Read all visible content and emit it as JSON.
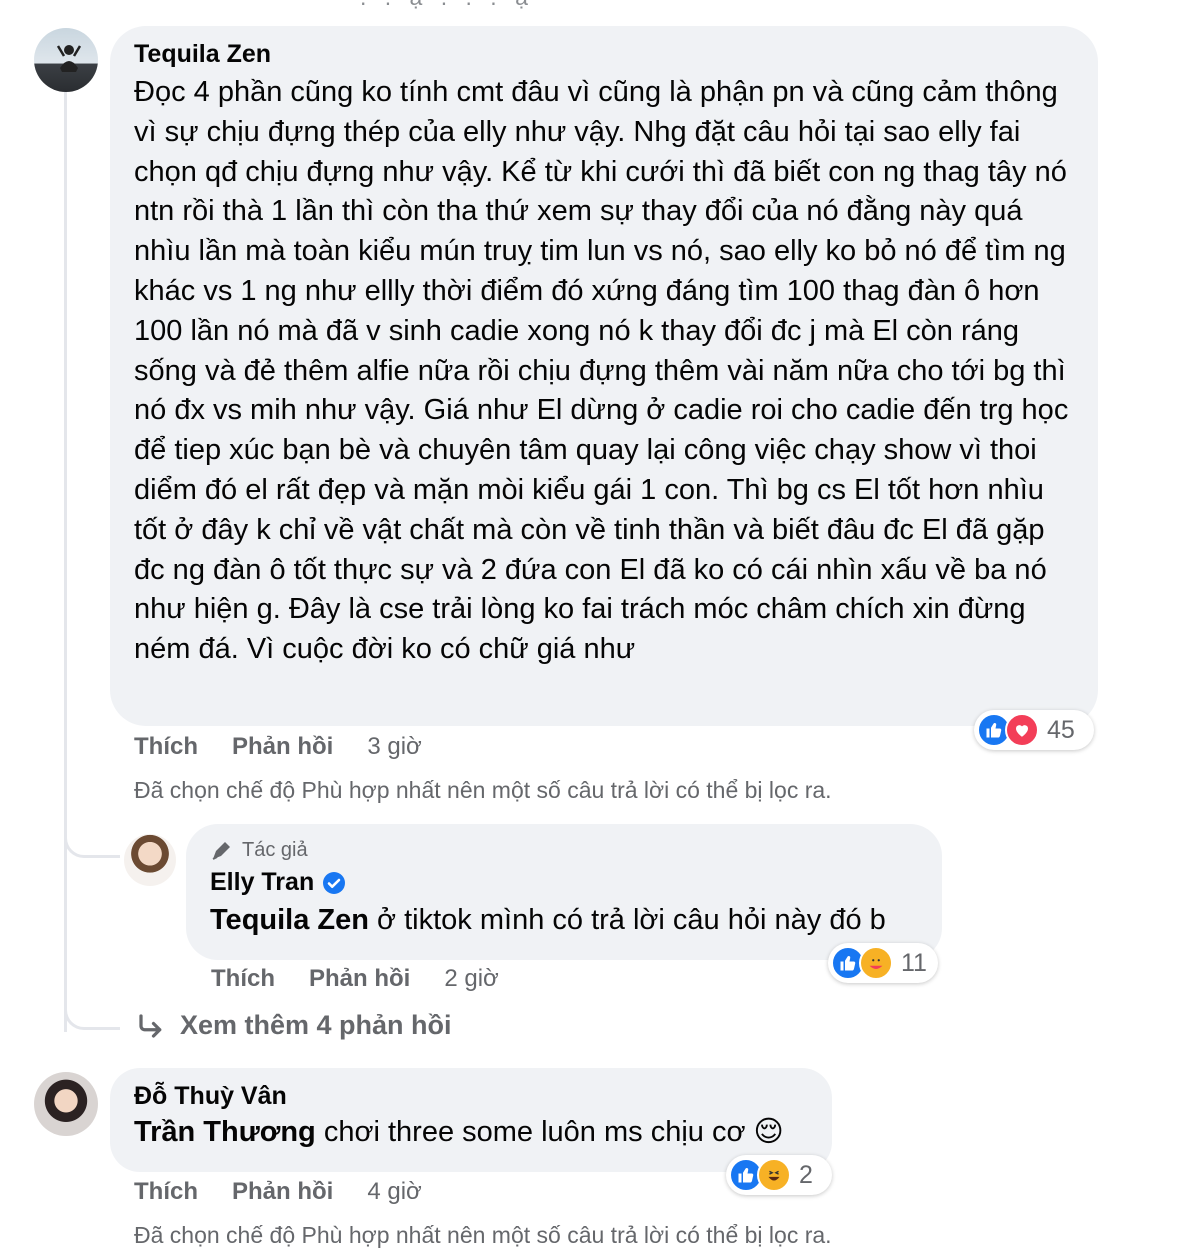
{
  "top_fragment": ". . ạ . . . ạ",
  "comments": [
    {
      "author": "Tequila Zen",
      "text": "Đọc 4 phần cũng ko tính cmt đâu vì cũng là phận pn và cũng cảm thông vì sự chịu đựng thép của elly như vậy. Nhg đặt câu hỏi tại sao elly fai chọn qđ chịu đựng như vậy. Kể từ khi cưới thì đã biết con ng thag tây nó ntn rồi thà 1 lần thì còn tha thứ xem sự thay đổi của nó đằng này quá nhìu lần mà toàn kiểu mún truỵ tim lun vs nó, sao elly ko bỏ nó để tìm ng khác vs 1 ng như ellly thời điểm đó xứng đáng tìm 100 thag đàn ô hơn 100 lần nó mà đã v sinh cadie xong nó k thay đổi đc j mà El còn ráng sống và đẻ thêm alfie nữa rồi chịu đựng thêm vài năm nữa cho tới bg thì nó đx vs mih như vậy. Giá như El dừng ở cadie roi cho cadie đến trg học để tiep xúc bạn bè và chuyên tâm quay lại công việc chạy show vì thoi diểm đó el rất đẹp và mặn mòi kiểu gái 1 con. Thì bg cs El tốt hơn nhìu tốt ở đây k chỉ về vật chất mà còn về tinh thần và biết đâu đc El đã gặp đc ng đàn ô tốt thực sự và 2 đứa con El đã ko có cái nhìn xấu về ba nó như hiện g. Đây là cse trải lòng ko fai trách móc châm chích xin đừng ném đá. Vì cuộc đời ko có chữ giá như",
      "like_label": "Thích",
      "reply_label": "Phản hồi",
      "time": "3 giờ",
      "reaction_count": "45",
      "reactions": [
        "like-icon",
        "love-icon"
      ],
      "filter_note": "Đã chọn chế độ Phù hợp nhất nên một số câu trả lời có thể bị lọc ra."
    },
    {
      "badge": "Tác giả",
      "author": "Elly Tran",
      "verified": true,
      "tag": "Tequila Zen",
      "text": " ở tiktok mình có trả lời câu hỏi này đó b",
      "like_label": "Thích",
      "reply_label": "Phản hồi",
      "time": "2 giờ",
      "reaction_count": "11",
      "reactions": [
        "like-icon",
        "care-icon"
      ]
    },
    {
      "author": "Đỗ Thuỳ Vân",
      "tag": "Trần Thương",
      "text": " chơi three some luôn ms chịu cơ ",
      "emoji": "😌",
      "like_label": "Thích",
      "reply_label": "Phản hồi",
      "time": "4 giờ",
      "reaction_count": "2",
      "reactions": [
        "like-icon",
        "haha-icon"
      ],
      "filter_note": "Đã chọn chế độ Phù hợp nhất nên một số câu trả lời có thể bị lọc ra."
    }
  ],
  "more_replies": {
    "label": "Xem thêm 4 phản hồi",
    "icon": "reply-arrow-icon"
  },
  "colors": {
    "bubble": "#f0f2f5",
    "secondary_text": "#65676b",
    "like_blue": "#1877f2",
    "love_red": "#f33e58",
    "haha_yellow": "#f7b125"
  }
}
